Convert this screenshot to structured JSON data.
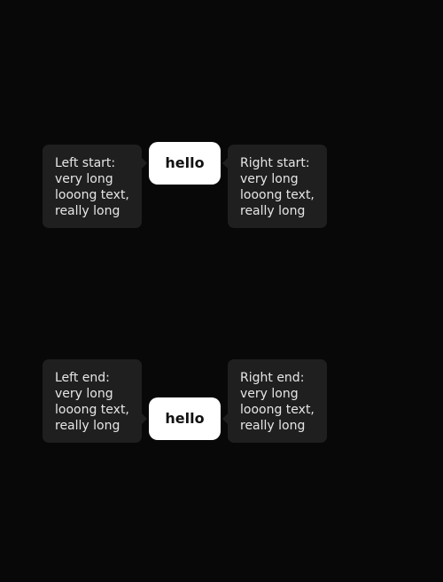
{
  "anchors": {
    "top_label": "hello",
    "bottom_label": "hello"
  },
  "tooltips": {
    "left_start": [
      "Left start:",
      "very long",
      "looong text,",
      "really long"
    ],
    "right_start": [
      "Right start:",
      "very long",
      "looong text,",
      "really long"
    ],
    "left_end": [
      "Left end:",
      "very long",
      "looong text,",
      "really long"
    ],
    "right_end": [
      "Right end:",
      "very long",
      "looong text,",
      "really long"
    ]
  },
  "colors": {
    "background": "#080808",
    "tooltip_bg": "#1f1f1f",
    "tooltip_text": "#e6e6e6",
    "anchor_bg": "#ffffff",
    "anchor_text": "#111111"
  }
}
